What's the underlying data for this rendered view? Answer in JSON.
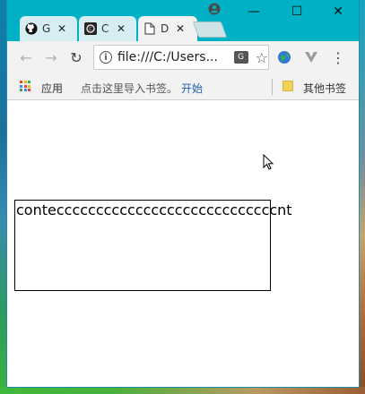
{
  "tabs": [
    {
      "title": "G",
      "icon": "github-icon"
    },
    {
      "title": "C",
      "icon": "app-icon"
    },
    {
      "title": "D",
      "icon": "page-icon",
      "active": true
    }
  ],
  "window_controls": {
    "minimize": "—",
    "maximize": "☐",
    "close": "✕"
  },
  "toolbar": {
    "back": "←",
    "forward": "→",
    "reload": "↻",
    "address": "file:///C:/Users...",
    "info": "i",
    "star": "☆",
    "menu": "⋮"
  },
  "bookmarks": {
    "apps_label": "应用",
    "import_text": "点击这里导入书签。",
    "start_link": "开始",
    "other_label": "其他书签"
  },
  "page": {
    "box_text": "conteccccccccccccccccccccccccccccnt"
  },
  "colors": {
    "titlebar": "#00b0c5",
    "active_tab": "#f2f2f2",
    "link": "#1a5fb4"
  }
}
